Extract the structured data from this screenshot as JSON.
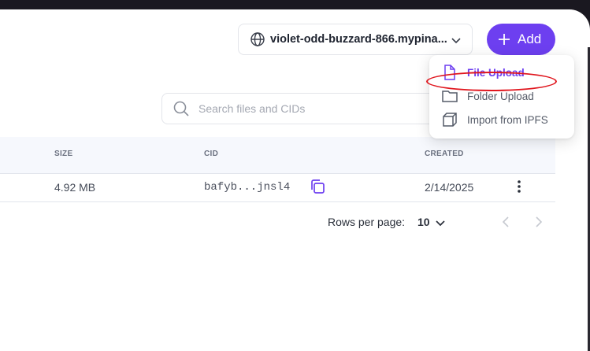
{
  "header": {
    "gateway_label": "violet-odd-buzzard-866.mypina...",
    "add_label": "Add"
  },
  "add_menu": {
    "items": [
      {
        "label": "File Upload",
        "icon": "file-icon",
        "active": true
      },
      {
        "label": "Folder Upload",
        "icon": "folder-icon"
      },
      {
        "label": "Import from IPFS",
        "icon": "cube-icon"
      }
    ]
  },
  "search": {
    "placeholder": "Search files and CIDs"
  },
  "table": {
    "columns": [
      "SIZE",
      "CID",
      "CREATED"
    ],
    "rows": [
      {
        "size": "4.92 MB",
        "cid": "bafyb...jnsl4",
        "created": "2/14/2025"
      }
    ]
  },
  "pagination": {
    "rows_per_page_label": "Rows per page:",
    "rows_per_page_value": "10"
  },
  "colors": {
    "accent": "#6d3ff0",
    "annotation": "#e0161e"
  }
}
